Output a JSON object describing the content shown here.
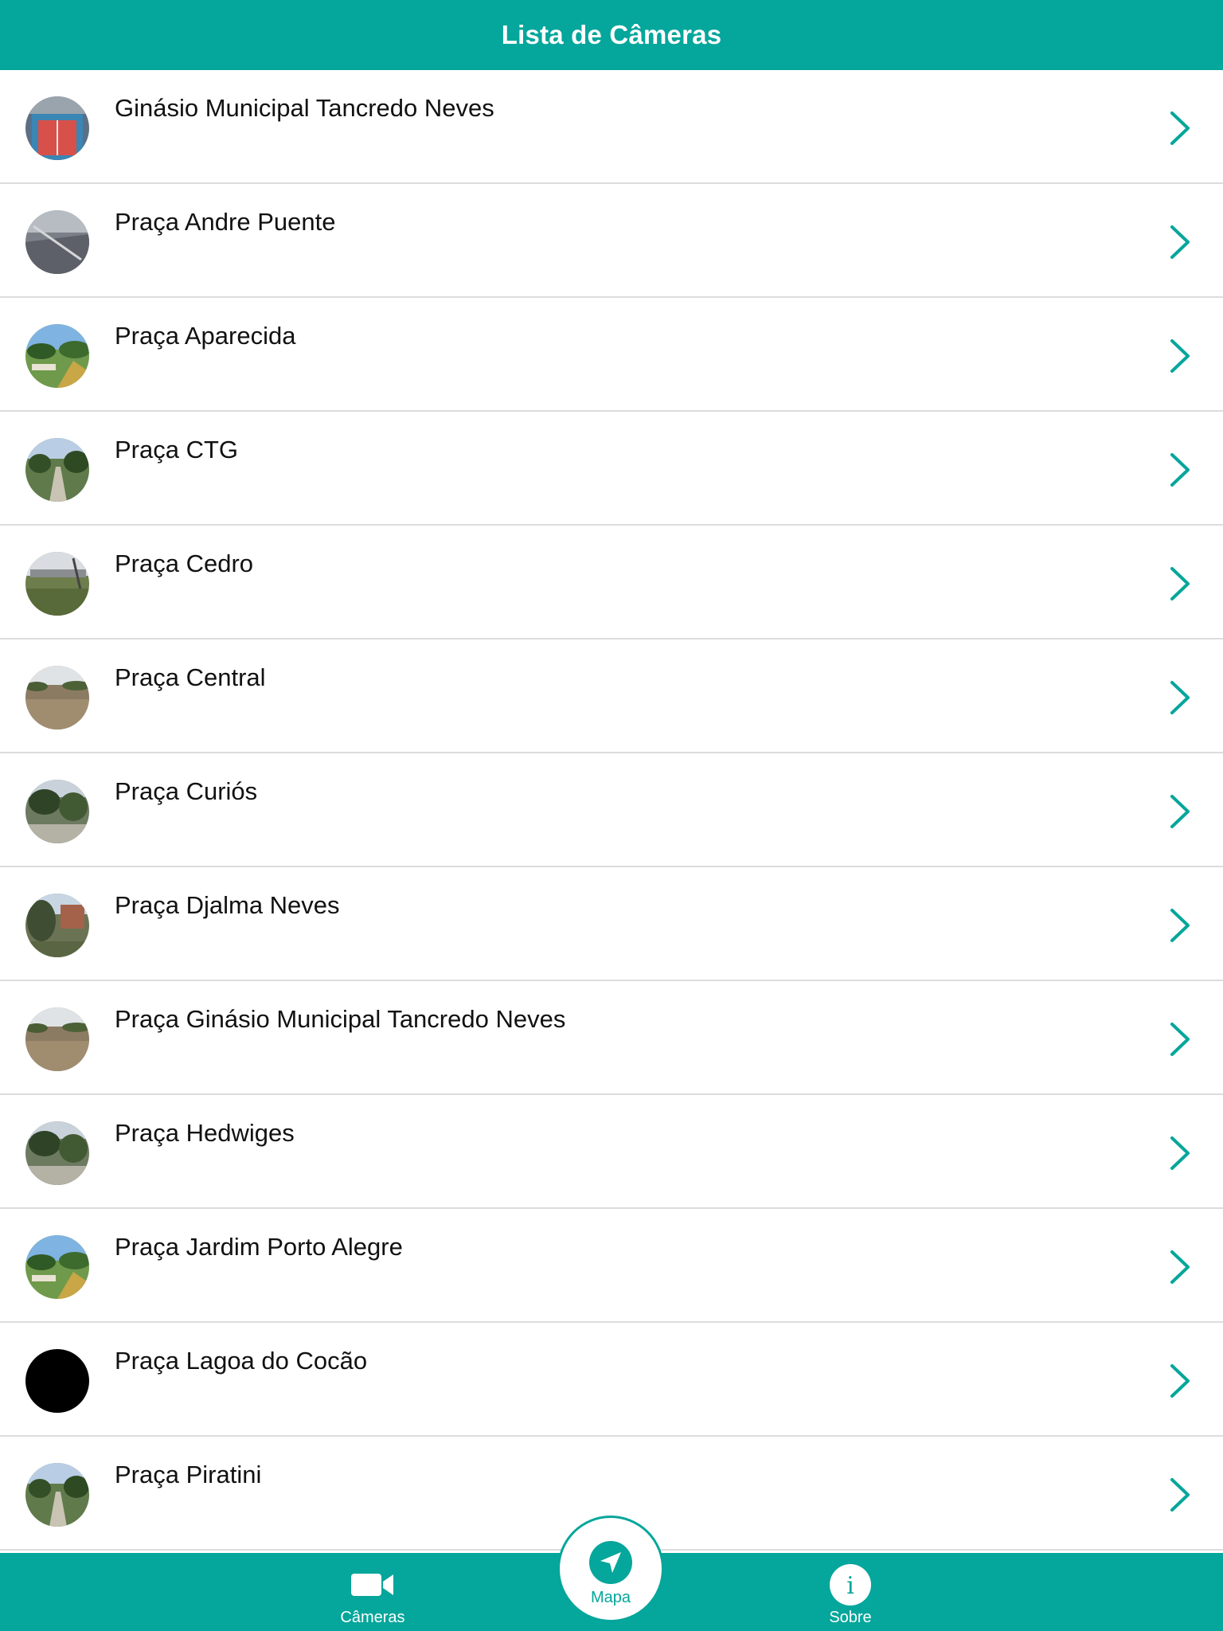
{
  "header": {
    "title": "Lista de Câmeras"
  },
  "colors": {
    "primary": "#05a69b",
    "divider": "#dcdcdc",
    "text": "#111111"
  },
  "cameras": [
    {
      "name": "Ginásio Municipal Tancredo Neves",
      "thumbnail": "court"
    },
    {
      "name": "Praça Andre Puente",
      "thumbnail": "square-gray"
    },
    {
      "name": "Praça Aparecida",
      "thumbnail": "park-sky"
    },
    {
      "name": "Praça CTG",
      "thumbnail": "park-path"
    },
    {
      "name": "Praça Cedro",
      "thumbnail": "park-field"
    },
    {
      "name": "Praça Central",
      "thumbnail": "park-dirt"
    },
    {
      "name": "Praça Curiós",
      "thumbnail": "park-trees"
    },
    {
      "name": "Praça Djalma Neves",
      "thumbnail": "park-building"
    },
    {
      "name": "Praça Ginásio Municipal Tancredo Neves",
      "thumbnail": "park-dirt"
    },
    {
      "name": "Praça Hedwiges",
      "thumbnail": "park-trees"
    },
    {
      "name": "Praça Jardim Porto Alegre",
      "thumbnail": "park-sky"
    },
    {
      "name": "Praça Lagoa do Cocão",
      "thumbnail": "offline-black"
    },
    {
      "name": "Praça Piratini",
      "thumbnail": "park-path"
    }
  ],
  "row_action_icon": "chevron-right-icon",
  "tabbar": {
    "cameras": {
      "label": "Câmeras",
      "icon": "video-camera-icon"
    },
    "map": {
      "label": "Mapa",
      "icon": "navigation-arrow-icon"
    },
    "about": {
      "label": "Sobre",
      "icon": "info-icon"
    }
  }
}
